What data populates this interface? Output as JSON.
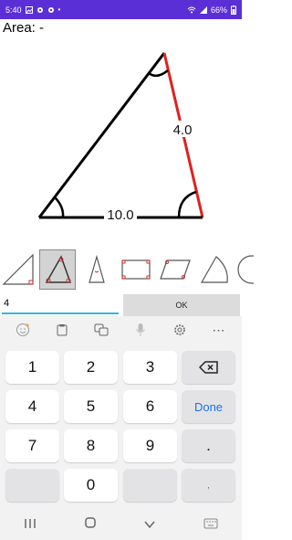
{
  "status_bar": {
    "time": "5:40",
    "battery": "66%"
  },
  "area_label": "Area: -",
  "triangle": {
    "side_right_label": "4.0",
    "side_bottom_label": "10.0"
  },
  "shapes": [
    "right-triangle",
    "triangle",
    "isosceles-triangle",
    "rectangle",
    "parallelogram",
    "sector",
    "circle"
  ],
  "input": {
    "value": "4"
  },
  "ok_label": "OK",
  "keyboard": {
    "toolbar": [
      "emoji-icon",
      "clipboard-icon",
      "translate-icon",
      "mic-icon",
      "settings-icon",
      "more-icon"
    ],
    "keys": {
      "k1": "1",
      "k2": "2",
      "k3": "3",
      "k4": "4",
      "k5": "5",
      "k6": "6",
      "k7": "7",
      "k8": "8",
      "k9": "9",
      "k0": "0",
      "done": "Done",
      "dot": ".",
      "comma": ","
    }
  },
  "colors": {
    "status_bar": "#5b2fd6",
    "highlight_side": "#e02020",
    "input_underline": "#33b5e5"
  }
}
